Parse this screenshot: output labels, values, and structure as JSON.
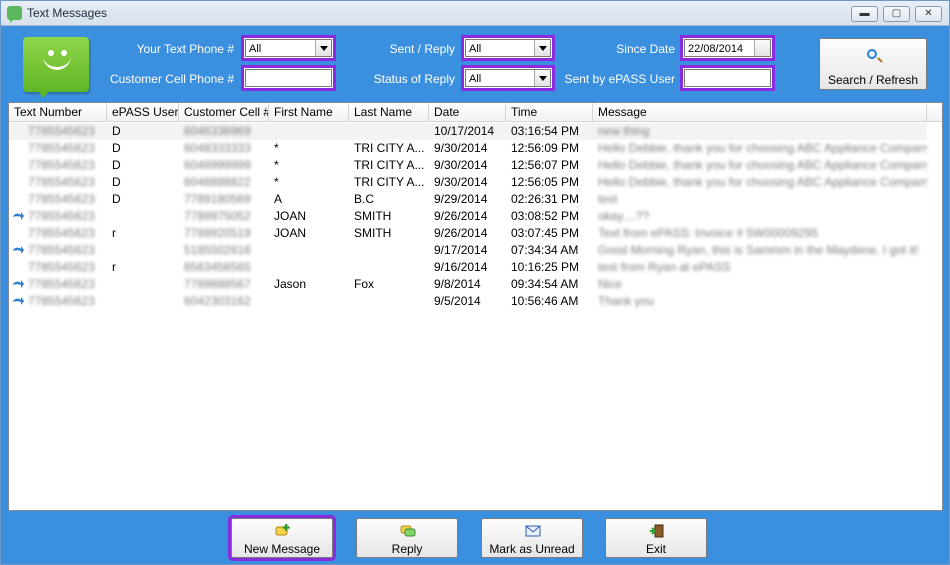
{
  "window": {
    "title": "Text Messages",
    "minimize": "▬",
    "maximize": "▢",
    "close": "✕"
  },
  "filters": {
    "your_text_phone_label": "Your Text Phone #",
    "your_text_phone_value": "All",
    "customer_cell_label": "Customer Cell Phone #",
    "customer_cell_value": "",
    "sent_reply_label": "Sent / Reply",
    "sent_reply_value": "All",
    "status_label": "Status of Reply",
    "status_value": "All",
    "since_date_label": "Since Date",
    "since_date_value": "22/08/2014",
    "sent_by_label": "Sent by ePASS User",
    "sent_by_value": ""
  },
  "search_button": {
    "label": "Search / Refresh"
  },
  "table": {
    "columns": [
      "Text Number",
      "ePASS User",
      "Customer Cell #",
      "First Name",
      "Last Name",
      "Date",
      "Time",
      "Message"
    ],
    "rows": [
      {
        "icon": "",
        "text_number": "7785545623",
        "user": "D",
        "cell": "6046336969",
        "first": "",
        "last": "",
        "date": "10/17/2014",
        "time": "03:16:54 PM",
        "message": "new thing",
        "selected": true
      },
      {
        "icon": "",
        "text_number": "7785545623",
        "user": "D",
        "cell": "6048333333",
        "first": "*",
        "last": "TRI CITY A...",
        "date": "9/30/2014",
        "time": "12:56:09 PM",
        "message": "Hello Debbie, thank you for choosing ABC Appliance Company! A..."
      },
      {
        "icon": "",
        "text_number": "7785545623",
        "user": "D",
        "cell": "6049999999",
        "first": "*",
        "last": "TRI CITY A...",
        "date": "9/30/2014",
        "time": "12:56:07 PM",
        "message": "Hello Debbie, thank you for choosing ABC Appliance Company! A..."
      },
      {
        "icon": "",
        "text_number": "7785545623",
        "user": "D",
        "cell": "6048888822",
        "first": "*",
        "last": "TRI CITY A...",
        "date": "9/30/2014",
        "time": "12:56:05 PM",
        "message": "Hello Debbie, thank you for choosing ABC Appliance Company! A..."
      },
      {
        "icon": "",
        "text_number": "7785545623",
        "user": "D",
        "cell": "7789180569",
        "first": "A",
        "last": "B.C",
        "date": "9/29/2014",
        "time": "02:26:31 PM",
        "message": "test"
      },
      {
        "icon": "reply",
        "text_number": "7785545623",
        "user": "",
        "cell": "7789975052",
        "first": "JOAN",
        "last": "SMITH",
        "date": "9/26/2014",
        "time": "03:08:52 PM",
        "message": "okay....??"
      },
      {
        "icon": "",
        "text_number": "7785545623",
        "user": "r",
        "cell": "7789920519",
        "first": "JOAN",
        "last": "SMITH",
        "date": "9/26/2014",
        "time": "03:07:45 PM",
        "message": "Text from ePASS: Invoice # 5W00009295"
      },
      {
        "icon": "reply",
        "text_number": "7785545623",
        "user": "",
        "cell": "5185502616",
        "first": "",
        "last": "",
        "date": "9/17/2014",
        "time": "07:34:34 AM",
        "message": "Good Morning Ryan, this is Sammm in the Maydene, I got it!"
      },
      {
        "icon": "",
        "text_number": "7785545623",
        "user": "r",
        "cell": "6563456565",
        "first": "",
        "last": "",
        "date": "9/16/2014",
        "time": "10:16:25 PM",
        "message": "test from Ryan at ePASS"
      },
      {
        "icon": "reply",
        "text_number": "7785545623",
        "user": "",
        "cell": "7789888567",
        "first": "Jason",
        "last": "Fox",
        "date": "9/8/2014",
        "time": "09:34:54 AM",
        "message": "Nice"
      },
      {
        "icon": "reply",
        "text_number": "7785545623",
        "user": "",
        "cell": "6042303162",
        "first": "",
        "last": "",
        "date": "9/5/2014",
        "time": "10:56:46 AM",
        "message": "Thank you"
      }
    ]
  },
  "buttons": {
    "new_message": "New Message",
    "reply": "Reply",
    "mark_unread": "Mark as Unread",
    "exit": "Exit"
  },
  "colors": {
    "background": "#3b8fdf",
    "highlight": "#8a2be2"
  }
}
